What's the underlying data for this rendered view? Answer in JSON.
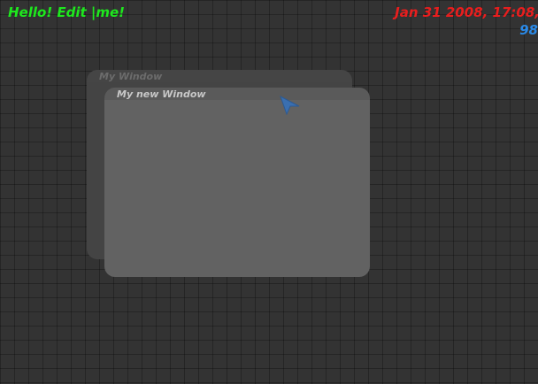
{
  "hud": {
    "edit_text": "Hello! Edit |me!",
    "datetime": "Jan 31 2008, 17:08,",
    "fps": "98",
    "colors": {
      "edit_text": "#1ee81e",
      "datetime": "#e81e1e",
      "fps": "#2a8ae8"
    }
  },
  "windows": [
    {
      "title": "My Window",
      "state": "inactive"
    },
    {
      "title": "My new Window",
      "state": "active"
    }
  ],
  "cursor": {
    "icon": "arrow-pointer-icon",
    "color": "#3a6fb0"
  }
}
